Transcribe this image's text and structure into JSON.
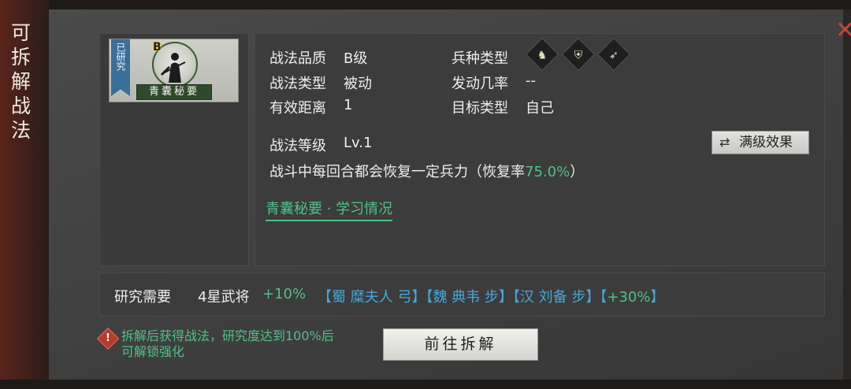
{
  "side_title": "可拆解战法",
  "close_label": "✕",
  "card": {
    "researched_tag": "已研究",
    "grade": "B",
    "name": "青囊秘要"
  },
  "info": {
    "quality_label": "战法品质",
    "quality_value": "B级",
    "type_label": "战法类型",
    "type_value": "被动",
    "range_label": "有效距离",
    "range_value": "1",
    "troop_label": "兵种类型",
    "troop_icons": [
      "cavalry-icon",
      "shield-icon",
      "bow-icon"
    ],
    "chance_label": "发动几率",
    "chance_value": "--",
    "target_label": "目标类型",
    "target_value": "自己",
    "level_label": "战法等级",
    "level_value": "Lv.1",
    "full_effect_button": "满级效果",
    "description_prefix": "战斗中每回合都会恢复一定兵力（恢复率",
    "description_rate": "75.0%",
    "description_suffix": "）",
    "study_link": "青囊秘要 · 学习情况"
  },
  "requirement": {
    "label": "研究需要",
    "item1": "4星武将",
    "item1_bonus": "+10%",
    "item2": "【蜀 糜夫人 弓】【魏 典韦 步】【汉 刘备 步】【",
    "item2_bonus": "+30%",
    "item2_close": "】"
  },
  "footer": {
    "warning_line1": "拆解后获得战法，研究度达到100%后",
    "warning_line2": "可解锁强化",
    "go_button": "前往拆解"
  },
  "colors": {
    "accent_green": "#4fc08a",
    "accent_blue": "#46a7d8",
    "close_red": "#c2453c"
  }
}
